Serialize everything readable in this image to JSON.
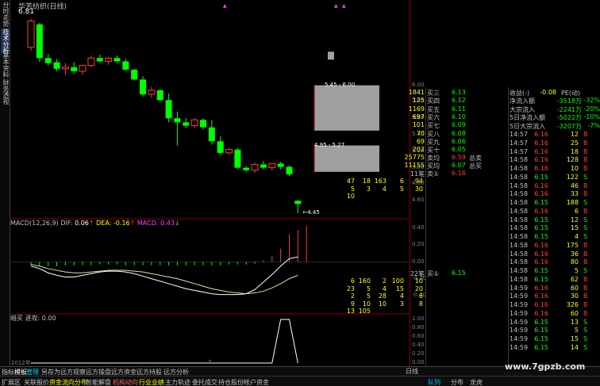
{
  "stock_title": "华芳纺织(日线)",
  "high_label": "6.81",
  "low_label": "4.45",
  "zone_label_upper": "5.45 - 6.00",
  "zone_label_lower": "4.95 - 5.27",
  "left_tabs": [
    "分时走势",
    "技术分析",
    "基本资料",
    "财务透视"
  ],
  "price_axis": [
    "6.00",
    "5.80",
    "5.60",
    "5.40",
    "5.20",
    "5.00",
    "4.80",
    "4.60"
  ],
  "macd_axis": [
    "0.40",
    "0.20",
    "0.00",
    "-0.20",
    "-0.40"
  ],
  "bg_axis": [
    "1.00",
    "0.80",
    "0.60",
    "0.40",
    "0.20",
    "0.00"
  ],
  "macd_legend": {
    "label": "MACD(12,26,9)",
    "dif_label": "DIF:",
    "dif_value": "0.06",
    "dea_label": "DEA:",
    "dea_value": "-0.16",
    "macd_label": "MACD:",
    "macd_value": "0.43"
  },
  "bg_legend": {
    "name": "暗买",
    "text": "进攻: 0.00"
  },
  "orderbook": {
    "asks": [
      {
        "label": "买三",
        "price": "6.13",
        "vol": "1841"
      },
      {
        "label": "买四",
        "price": "6.12",
        "vol": "125"
      },
      {
        "label": "买五",
        "price": "6.11",
        "vol": "1169"
      },
      {
        "label": "买六",
        "price": "6.10",
        "vol": "697"
      },
      {
        "label": "买七",
        "price": "6.09",
        "vol": "101"
      },
      {
        "label": "买八",
        "price": "6.08",
        "vol": "70"
      },
      {
        "label": "买九",
        "price": "6.06",
        "vol": "69"
      },
      {
        "label": "买十",
        "price": "6.05",
        "vol": "202"
      }
    ],
    "avg_sell": {
      "label": "卖均",
      "price": "6.59",
      "tlabel": "总卖",
      "total": "25775"
    },
    "avg_buy": {
      "label": "买均",
      "price": "6.07",
      "tlabel": "总买",
      "total": "11155"
    },
    "sell1": {
      "label": "卖①",
      "price": "6.16",
      "count": "11笔"
    },
    "sell1_queue": [
      [
        "47",
        "18",
        "163",
        "6",
        "94"
      ],
      [
        "5",
        "3",
        "4",
        "5",
        "30"
      ],
      [
        "10",
        "",
        "",
        "",
        ""
      ]
    ],
    "buy1": {
      "label": "买①",
      "price": "6.15",
      "count": "22笔"
    },
    "buy1_queue": [
      [
        "6",
        "160",
        "2",
        "100",
        "10"
      ],
      [
        "23",
        "5",
        "4",
        "15",
        "20"
      ],
      [
        "2",
        "5",
        "28",
        "4",
        "6"
      ],
      [
        "9",
        "10",
        "10",
        "3",
        "8"
      ],
      [
        "13",
        "105",
        "",
        "",
        ""
      ]
    ]
  },
  "fundflow": {
    "header": {
      "label": "收益(-)",
      "value": "-0.08",
      "pe_label": "PE(动)"
    },
    "rows": [
      {
        "label": "净流入额",
        "value": "-3518万",
        "pct": "-32%"
      },
      {
        "label": "大宗流入",
        "value": "-2241万",
        "pct": "-20%"
      },
      {
        "label": "5日净流入额",
        "value": "-5022万",
        "pct": "-10%"
      },
      {
        "label": "5日大宗流入",
        "value": "-3207万",
        "pct": "-7%"
      }
    ]
  },
  "ticks": [
    {
      "t": "14:57",
      "p": "6.16",
      "v": "12",
      "s": "B"
    },
    {
      "t": "14:57",
      "p": "6.16",
      "v": "25",
      "s": "B"
    },
    {
      "t": "14:57",
      "p": "6.16",
      "v": "18",
      "s": "B"
    },
    {
      "t": "14:58",
      "p": "6.16",
      "v": "128",
      "s": "B"
    },
    {
      "t": "14:58",
      "p": "6.16",
      "v": "10",
      "s": "B"
    },
    {
      "t": "14:58",
      "p": "6.15",
      "v": "122",
      "s": "S"
    },
    {
      "t": "14:58",
      "p": "6.16",
      "v": "46",
      "s": "B"
    },
    {
      "t": "14:58",
      "p": "6.16",
      "v": "33",
      "s": "B"
    },
    {
      "t": "14:58",
      "p": "6.15",
      "v": "188",
      "s": "S"
    },
    {
      "t": "14:58",
      "p": "6.16",
      "v": "6",
      "s": "B"
    },
    {
      "t": "14:58",
      "p": "6.15",
      "v": "12",
      "s": "S"
    },
    {
      "t": "14:58",
      "p": "6.15",
      "v": "15",
      "s": "S"
    },
    {
      "t": "14:58",
      "p": "6.15",
      "v": "4",
      "s": "S"
    },
    {
      "t": "14:58",
      "p": "6.16",
      "v": "175",
      "s": "B"
    },
    {
      "t": "14:58",
      "p": "6.16",
      "v": "36",
      "s": "B"
    },
    {
      "t": "14:58",
      "p": "6.16",
      "v": "80",
      "s": "B"
    },
    {
      "t": "14:58",
      "p": "6.15",
      "v": "5",
      "s": "S"
    },
    {
      "t": "14:58",
      "p": "6.15",
      "v": "62",
      "s": "B"
    },
    {
      "t": "14:59",
      "p": "6.16",
      "v": "60",
      "s": "B"
    },
    {
      "t": "14:59",
      "p": "6.16",
      "v": "30",
      "s": "B"
    },
    {
      "t": "14:59",
      "p": "6.16",
      "v": "326",
      "s": "B"
    },
    {
      "t": "14:59",
      "p": "6.16",
      "v": "60",
      "s": "B"
    },
    {
      "t": "14:59",
      "p": "6.15",
      "v": "13",
      "s": "S"
    },
    {
      "t": "14:59",
      "p": "6.15",
      "v": "5",
      "s": "S"
    },
    {
      "t": "14:59",
      "p": "6.15",
      "v": "15",
      "s": "S"
    },
    {
      "t": "14:59",
      "p": "6.15",
      "v": "14",
      "s": "S"
    }
  ],
  "bottom_tabs1": [
    "指标",
    "模板",
    "管理",
    "另存为",
    "远方观察",
    "远方操盘",
    "远方资金",
    "远方持股",
    "远方分析"
  ],
  "bottom_tabs2": [
    "扩展区",
    "关联报价",
    "资金流向分布",
    "智能解盘",
    "机构动向",
    "行业业绩",
    "主力轨迹",
    "委托成交",
    "持仓股份",
    "帐户资金"
  ],
  "period_label": "日线",
  "right_bottom_tabs": [
    "队列",
    "分布",
    "龙虎"
  ],
  "year_label": "2012年",
  "month_label": "7",
  "watermark": "www.7gpzb.com",
  "chart_data": {
    "type": "candlestick",
    "candles": [
      {
        "o": 6.46,
        "h": 6.81,
        "l": 6.42,
        "c": 6.78,
        "up": true
      },
      {
        "o": 6.74,
        "h": 6.76,
        "l": 6.28,
        "c": 6.33,
        "up": false
      },
      {
        "o": 6.33,
        "h": 6.38,
        "l": 6.24,
        "c": 6.27,
        "up": false
      },
      {
        "o": 6.28,
        "h": 6.32,
        "l": 6.17,
        "c": 6.2,
        "up": false
      },
      {
        "o": 6.2,
        "h": 6.27,
        "l": 6.13,
        "c": 6.22,
        "up": true
      },
      {
        "o": 6.22,
        "h": 6.28,
        "l": 6.14,
        "c": 6.17,
        "up": false
      },
      {
        "o": 6.17,
        "h": 6.25,
        "l": 6.13,
        "c": 6.24,
        "up": true
      },
      {
        "o": 6.24,
        "h": 6.36,
        "l": 6.22,
        "c": 6.33,
        "up": true
      },
      {
        "o": 6.33,
        "h": 6.37,
        "l": 6.27,
        "c": 6.29,
        "up": false
      },
      {
        "o": 6.29,
        "h": 6.34,
        "l": 6.25,
        "c": 6.33,
        "up": true
      },
      {
        "o": 6.33,
        "h": 6.36,
        "l": 6.27,
        "c": 6.29,
        "up": false
      },
      {
        "o": 6.29,
        "h": 6.32,
        "l": 6.17,
        "c": 6.19,
        "up": false
      },
      {
        "o": 6.19,
        "h": 6.2,
        "l": 6.06,
        "c": 6.07,
        "up": false
      },
      {
        "o": 6.07,
        "h": 6.11,
        "l": 5.86,
        "c": 5.89,
        "up": false
      },
      {
        "o": 5.89,
        "h": 5.98,
        "l": 5.85,
        "c": 5.94,
        "up": true
      },
      {
        "o": 5.94,
        "h": 5.95,
        "l": 5.8,
        "c": 5.82,
        "up": false
      },
      {
        "o": 5.82,
        "h": 5.9,
        "l": 5.55,
        "c": 5.6,
        "up": false
      },
      {
        "o": 5.6,
        "h": 5.68,
        "l": 5.27,
        "c": 5.55,
        "up": false
      },
      {
        "o": 5.55,
        "h": 5.6,
        "l": 5.48,
        "c": 5.51,
        "up": false
      },
      {
        "o": 5.51,
        "h": 5.6,
        "l": 5.48,
        "c": 5.58,
        "up": true
      },
      {
        "o": 5.58,
        "h": 5.6,
        "l": 5.46,
        "c": 5.49,
        "up": false
      },
      {
        "o": 5.49,
        "h": 5.58,
        "l": 5.28,
        "c": 5.32,
        "up": false
      },
      {
        "o": 5.32,
        "h": 5.38,
        "l": 5.16,
        "c": 5.18,
        "up": false
      },
      {
        "o": 5.18,
        "h": 5.24,
        "l": 5.16,
        "c": 5.22,
        "up": true
      },
      {
        "o": 5.22,
        "h": 5.24,
        "l": 4.98,
        "c": 5.0,
        "up": false
      },
      {
        "o": 5.0,
        "h": 5.02,
        "l": 4.95,
        "c": 4.97,
        "up": false
      },
      {
        "o": 4.97,
        "h": 5.06,
        "l": 4.94,
        "c": 5.04,
        "up": true
      },
      {
        "o": 5.04,
        "h": 5.08,
        "l": 4.98,
        "c": 5.0,
        "up": false
      },
      {
        "o": 5.0,
        "h": 5.06,
        "l": 4.97,
        "c": 5.05,
        "up": true
      },
      {
        "o": 5.05,
        "h": 5.07,
        "l": 4.98,
        "c": 5.01,
        "up": false
      },
      {
        "o": 5.01,
        "h": 5.03,
        "l": 4.9,
        "c": 4.92,
        "up": false
      },
      {
        "o": 4.6,
        "h": 4.6,
        "l": 4.45,
        "c": 4.56,
        "up": false
      }
    ],
    "macd": [
      -0.04,
      -0.05,
      -0.05,
      -0.05,
      -0.04,
      -0.04,
      -0.04,
      -0.04,
      -0.03,
      -0.03,
      -0.03,
      -0.04,
      -0.04,
      -0.04,
      -0.04,
      -0.04,
      -0.04,
      -0.04,
      -0.04,
      -0.04,
      -0.04,
      -0.04,
      -0.04,
      -0.03,
      -0.03,
      -0.03,
      -0.02,
      0.02,
      0.07,
      0.16,
      0.33,
      0.38,
      0.43
    ],
    "dif": [
      -0.05,
      -0.08,
      -0.13,
      -0.16,
      -0.18,
      -0.18,
      -0.16,
      -0.14,
      -0.12,
      -0.11,
      -0.11,
      -0.12,
      -0.14,
      -0.17,
      -0.2,
      -0.23,
      -0.26,
      -0.29,
      -0.32,
      -0.34,
      -0.36,
      -0.38,
      -0.39,
      -0.39,
      -0.39,
      -0.38,
      -0.33,
      -0.24,
      -0.15,
      -0.05,
      0.04,
      0.06
    ],
    "dea": [
      -0.03,
      -0.05,
      -0.08,
      -0.1,
      -0.12,
      -0.13,
      -0.13,
      -0.12,
      -0.11,
      -0.1,
      -0.1,
      -0.1,
      -0.11,
      -0.12,
      -0.14,
      -0.16,
      -0.18,
      -0.2,
      -0.23,
      -0.26,
      -0.29,
      -0.32,
      -0.34,
      -0.36,
      -0.37,
      -0.38,
      -0.37,
      -0.35,
      -0.31,
      -0.26,
      -0.2,
      -0.16
    ],
    "signal": [
      0,
      0,
      0,
      0,
      0,
      0,
      0,
      0,
      0,
      0,
      0,
      0,
      0,
      0,
      0,
      0,
      0,
      0,
      0,
      0,
      0,
      0,
      0,
      0,
      0,
      0,
      0,
      0,
      0,
      1,
      1,
      0
    ],
    "zones": [
      {
        "low": 5.45,
        "high": 6.0
      },
      {
        "low": 4.95,
        "high": 5.27
      }
    ],
    "price_range": [
      4.4,
      6.9
    ],
    "macd_range": [
      -0.45,
      0.45
    ]
  }
}
